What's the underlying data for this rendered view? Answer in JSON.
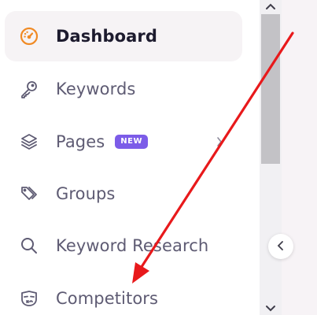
{
  "sidebar": {
    "items": [
      {
        "label": "Dashboard",
        "icon": "dashboard-gauge-icon",
        "active": true
      },
      {
        "label": "Keywords",
        "icon": "key-icon"
      },
      {
        "label": "Pages",
        "icon": "layers-icon",
        "badge": "NEW",
        "has_submenu": true
      },
      {
        "label": "Groups",
        "icon": "tags-icon"
      },
      {
        "label": "Keyword Research",
        "icon": "search-icon"
      },
      {
        "label": "Competitors",
        "icon": "mask-icon"
      }
    ]
  },
  "colors": {
    "accent_orange": "#f08a24",
    "badge_purple": "#7c5ce8",
    "active_bg": "#f6f3f5",
    "annotation_red": "#e8191b"
  },
  "annotation": {
    "type": "red-arrow",
    "points_to": "Competitors"
  }
}
